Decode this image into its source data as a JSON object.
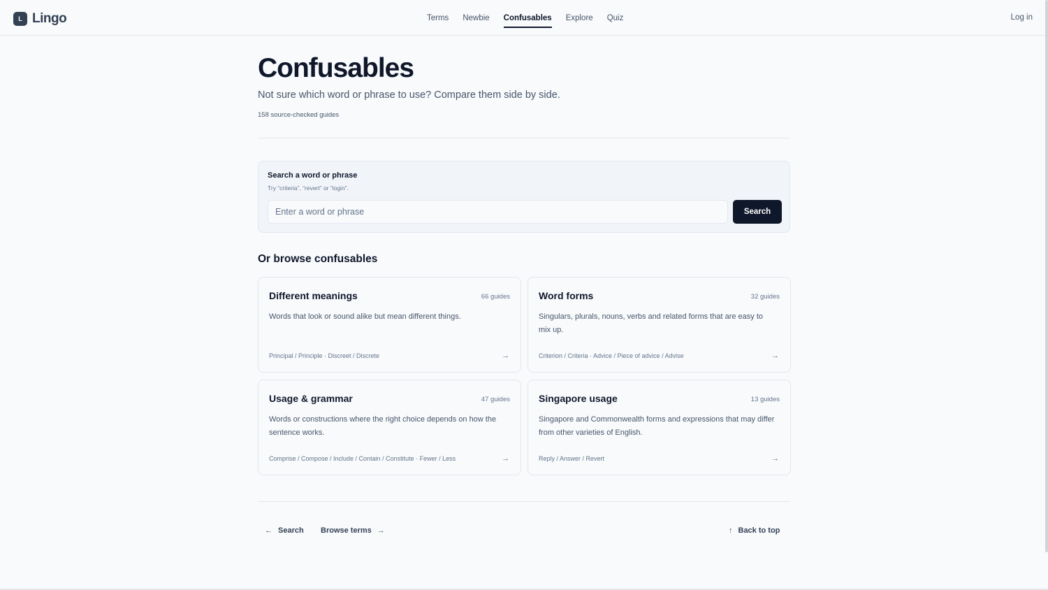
{
  "header": {
    "logo_mark": "L",
    "logo_text": "Lingo",
    "nav": [
      {
        "label": "Terms",
        "active": false
      },
      {
        "label": "Newbie",
        "active": false
      },
      {
        "label": "Confusables",
        "active": true
      },
      {
        "label": "Explore",
        "active": false
      },
      {
        "label": "Quiz",
        "active": false
      }
    ],
    "login": "Log in"
  },
  "page": {
    "title": "Confusables",
    "subtitle": "Not sure which word or phrase to use? Compare them side by side.",
    "count": "158 source-checked guides"
  },
  "search": {
    "label": "Search a word or phrase",
    "hint": "Try “criteria”, “revert” or “login”.",
    "placeholder": "Enter a word or phrase",
    "value": "",
    "button": "Search"
  },
  "browse": {
    "heading": "Or browse confusables",
    "cards": [
      {
        "title": "Different meanings",
        "count": "66 guides",
        "description": "Words that look or sound alike but mean different things.",
        "examples": "Principal / Principle · Discreet / Discrete",
        "arrow_icon": "arrow-right-icon"
      },
      {
        "title": "Word forms",
        "count": "32 guides",
        "description": "Singulars, plurals, nouns, verbs and related forms that are easy to mix up.",
        "examples": "Criterion / Criteria · Advice / Piece of advice / Advise",
        "arrow_icon": "arrow-right-icon"
      },
      {
        "title": "Usage & grammar",
        "count": "47 guides",
        "description": "Words or constructions where the right choice depends on how the sentence works.",
        "examples": "Comprise / Compose / Include / Contain / Constitute · Fewer / Less",
        "arrow_icon": "arrow-right-icon"
      },
      {
        "title": "Singapore usage",
        "count": "13 guides",
        "description": "Singapore and Commonwealth forms and expressions that may differ from other varieties of English.",
        "examples": "Reply / Answer / Revert",
        "arrow_icon": "arrow-right-icon"
      }
    ]
  },
  "footer": {
    "back_search": "Search",
    "browse_terms": "Browse terms",
    "back_to_top": "Back to top"
  },
  "colors": {
    "background": "#f8fafc",
    "primary": "#0f172a",
    "muted": "#475569",
    "border": "#e2e8f0"
  }
}
